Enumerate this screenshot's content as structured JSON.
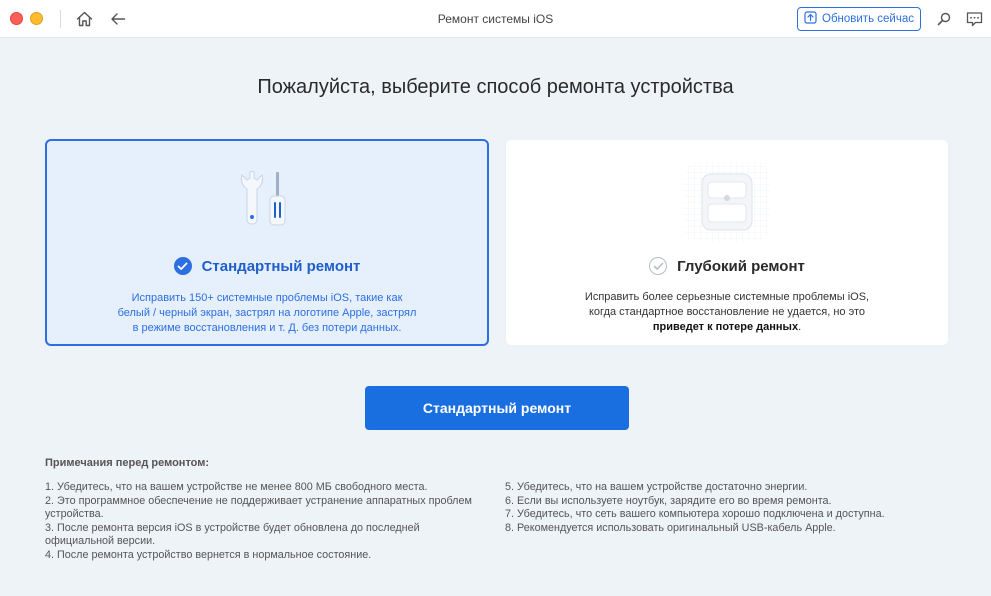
{
  "window": {
    "title": "Ремонт системы iOS",
    "update_button": "Обновить сейчас"
  },
  "main": {
    "title": "Пожалуйста, выберите способ ремонта устройства",
    "standard": {
      "heading": "Стандартный ремонт",
      "desc_lines": [
        "Исправить 150+ системные проблемы iOS, такие как",
        "белый / черный экран, застрял на логотипе Apple, застрял",
        "в режиме восстановления и т. Д. без потери данных."
      ],
      "selected": true
    },
    "deep": {
      "heading": "Глубокий ремонт",
      "desc_line1": "Исправить более серьезные системные проблемы iOS,",
      "desc_line2": "когда стандартное восстановление не удается, но это",
      "desc_bold": "приведет к потере данных",
      "desc_end": ".",
      "selected": false
    },
    "primary_button": "Стандартный ремонт"
  },
  "notes": {
    "title": "Примечания перед ремонтом:",
    "left": [
      "1. Убедитесь, что на вашем устройстве не менее 800 МБ свободного места.",
      "2. Это программное обеспечение не поддерживает устранение аппаратных проблем устройства.",
      "3. После ремонта версия iOS в устройстве будет обновлена до последней официальной версии.",
      "4. После ремонта устройство вернется в нормальное состояние."
    ],
    "right": [
      "5. Убедитесь, что на вашем устройстве достаточно энергии.",
      "6. Если вы используете ноутбук, зарядите его во время ремонта.",
      "7. Убедитесь, что сеть вашего компьютера хорошо подключена и доступна.",
      "8. Рекомендуется использовать оригинальный USB-кабель Apple."
    ]
  },
  "colors": {
    "accent": "#2c6fe0",
    "primary_button": "#1a6fe0",
    "background": "#eef3f8",
    "close": "#fe5f57",
    "minimize": "#febc2e"
  },
  "icons": [
    "home-icon",
    "back-arrow-icon",
    "update-icon",
    "search-icon",
    "feedback-icon",
    "repair-tools-icon",
    "device-icon",
    "check-icon"
  ]
}
